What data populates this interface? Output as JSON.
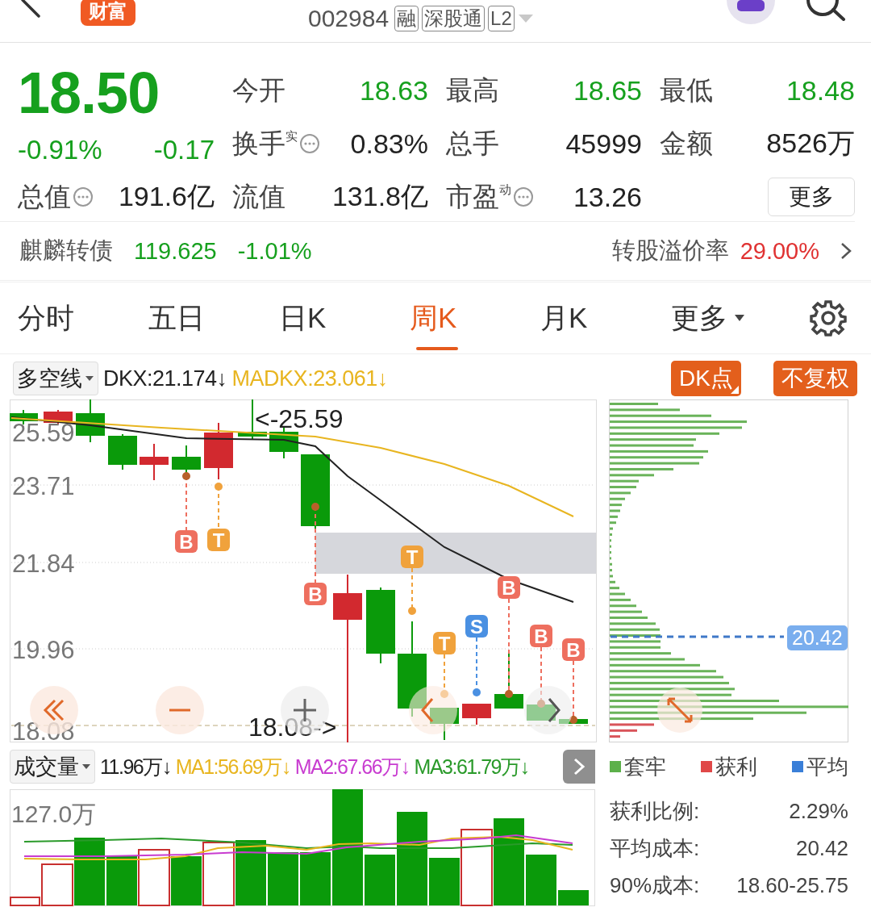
{
  "header": {
    "logo": "财富",
    "code": "002984",
    "tags": [
      "融",
      "深股通",
      "L2"
    ]
  },
  "quote": {
    "price": "18.50",
    "change_pct": "-0.91%",
    "change": "-0.17",
    "color": "#16a01e",
    "stats": [
      {
        "label": "今开",
        "info": false,
        "value": "18.63",
        "color": "#16a01e"
      },
      {
        "label": "最高",
        "info": false,
        "value": "18.65",
        "color": "#16a01e"
      },
      {
        "label": "最低",
        "info": false,
        "value": "18.48",
        "color": "#16a01e"
      },
      {
        "label": "换手",
        "sup": "实",
        "info": true,
        "value": "0.83%",
        "color": "#222222"
      },
      {
        "label": "总手",
        "info": false,
        "value": "45999",
        "color": "#222222"
      },
      {
        "label": "金额",
        "info": false,
        "value": "8526万",
        "color": "#222222"
      },
      {
        "label": "总值",
        "info": true,
        "value": "191.6亿",
        "color": "#222222"
      },
      {
        "label": "流值",
        "info": false,
        "value": "131.8亿",
        "color": "#222222"
      },
      {
        "label": "市盈",
        "sup": "动",
        "info": true,
        "value": "13.26",
        "color": "#222222"
      }
    ],
    "more_button": "更多"
  },
  "bond": {
    "name": "麒麟转债",
    "price": "119.625",
    "change": "-1.01%",
    "color": "#16a01e",
    "premium_label": "转股溢价率",
    "premium": "29.00%"
  },
  "tabs": [
    {
      "label": "分时",
      "selected": false,
      "dropdown": false
    },
    {
      "label": "五日",
      "selected": false,
      "dropdown": false
    },
    {
      "label": "日K",
      "selected": false,
      "dropdown": false
    },
    {
      "label": "周K",
      "selected": true,
      "dropdown": false
    },
    {
      "label": "月K",
      "selected": false,
      "dropdown": false
    },
    {
      "label": "更多",
      "selected": false,
      "dropdown": true
    }
  ],
  "chart": {
    "indicator": "多空线",
    "readings": [
      {
        "text": "DKX:21.174↓",
        "color": "#222222"
      },
      {
        "text": "MADKX:23.061↓",
        "color": "#e8b520"
      }
    ],
    "buttons": [
      "DK点",
      "不复权"
    ],
    "y_labels": [
      "25.59",
      "23.71",
      "21.84",
      "19.96",
      "18.08"
    ],
    "high_note": "<-25.59",
    "low_note": "18.08->",
    "signals": [
      {
        "label": "B",
        "kind": "buy"
      },
      {
        "label": "T",
        "kind": "t"
      },
      {
        "label": "B",
        "kind": "buy"
      },
      {
        "label": "T",
        "kind": "t"
      },
      {
        "label": "T",
        "kind": "t"
      },
      {
        "label": "S",
        "kind": "sell"
      },
      {
        "label": "B",
        "kind": "buy"
      },
      {
        "label": "B",
        "kind": "buy"
      },
      {
        "label": "B",
        "kind": "buy"
      }
    ],
    "chip_price": "20.42"
  },
  "volume": {
    "indicator": "成交量",
    "readings": [
      {
        "text": "11.96万↓",
        "color": "#222222"
      },
      {
        "text": "MA1:56.69万↓",
        "color": "#e8b520"
      },
      {
        "text": "MA2:67.66万↓",
        "color": "#c83cd0"
      },
      {
        "text": "MA3:61.79万↓",
        "color": "#2a9a2a"
      }
    ],
    "max_label": "127.0万"
  },
  "chip_legend": [
    {
      "label": "套牢",
      "color": "#5cb04a"
    },
    {
      "label": "获利",
      "color": "#e04848"
    },
    {
      "label": "平均",
      "color": "#3a7fd8"
    }
  ],
  "chip_stats": [
    {
      "label": "获利比例:",
      "value": "2.29%"
    },
    {
      "label": "平均成本:",
      "value": "20.42"
    },
    {
      "label": "90%成本:",
      "value": "18.60-25.75"
    }
  ]
}
